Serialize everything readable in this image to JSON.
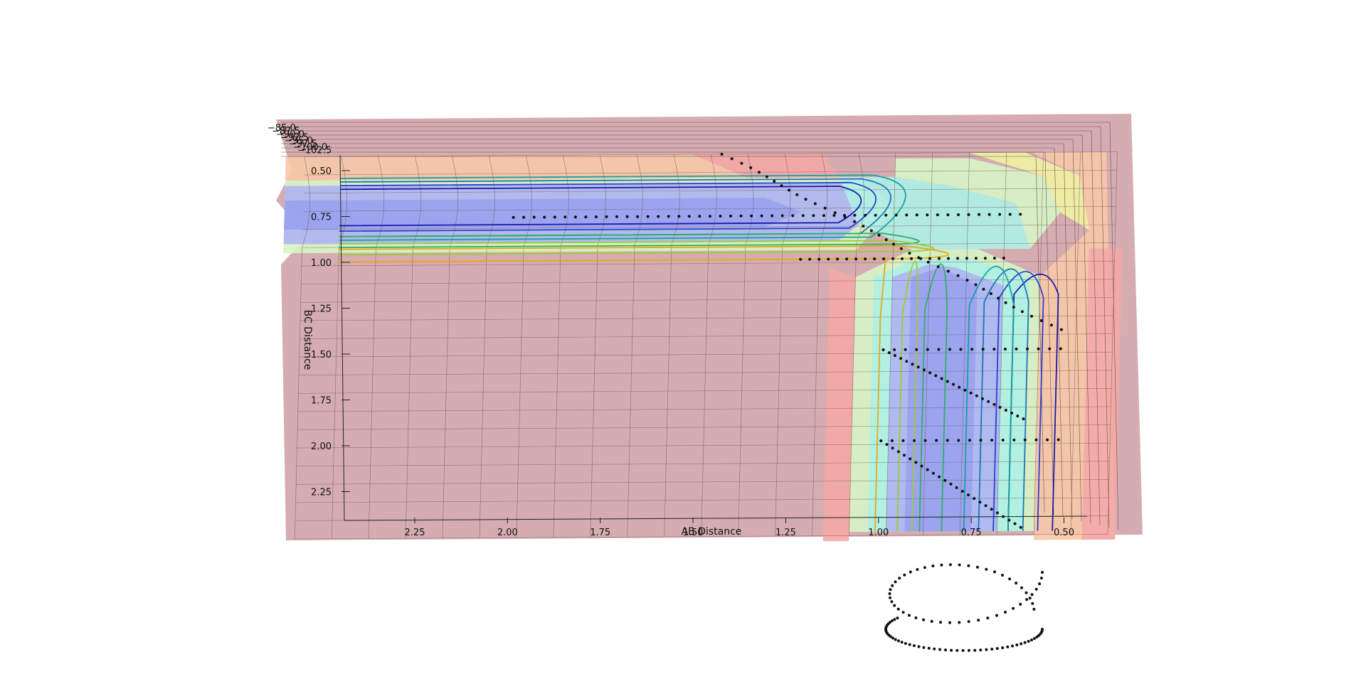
{
  "chart_data": {
    "type": "surface3d",
    "title": "",
    "xlabel": "AB Distance",
    "ylabel": "BC Distance",
    "zlabel": "",
    "x_ticks": [
      "2.25",
      "2.00",
      "1.75",
      "1.50",
      "1.25",
      "1.00",
      "0.75",
      "0.50"
    ],
    "y_ticks": [
      "0.50",
      "0.75",
      "1.00",
      "1.25",
      "1.50",
      "1.75",
      "2.00",
      "2.25"
    ],
    "z_ticks": [
      "−85.0",
      "−87.5",
      "−90.0",
      "−92.5",
      "−95.0",
      "−97.5",
      "−100.0",
      "−102.5"
    ],
    "xlim": [
      0.4,
      2.45
    ],
    "ylim": [
      0.4,
      2.45
    ],
    "contour_levels": [
      -101,
      -100,
      -99,
      -98,
      -96,
      -94,
      -92
    ],
    "contour_colors": [
      "#1a1aa8",
      "#2a3fcf",
      "#1f73b8",
      "#17a0a0",
      "#30b060",
      "#9acd32",
      "#e6a817"
    ],
    "trajectory_description": "",
    "grid": true,
    "legend": "none",
    "colors": {
      "surface_base": "#d3a9ad",
      "band_blue": "#aeb4f2",
      "band_cyan": "#aef0e6",
      "band_green": "#d7f5c6",
      "band_yellow": "#f1f3a3",
      "band_orange": "#f7c9a8",
      "band_red": "#f4a9a7",
      "trajectory": "#111111"
    }
  }
}
